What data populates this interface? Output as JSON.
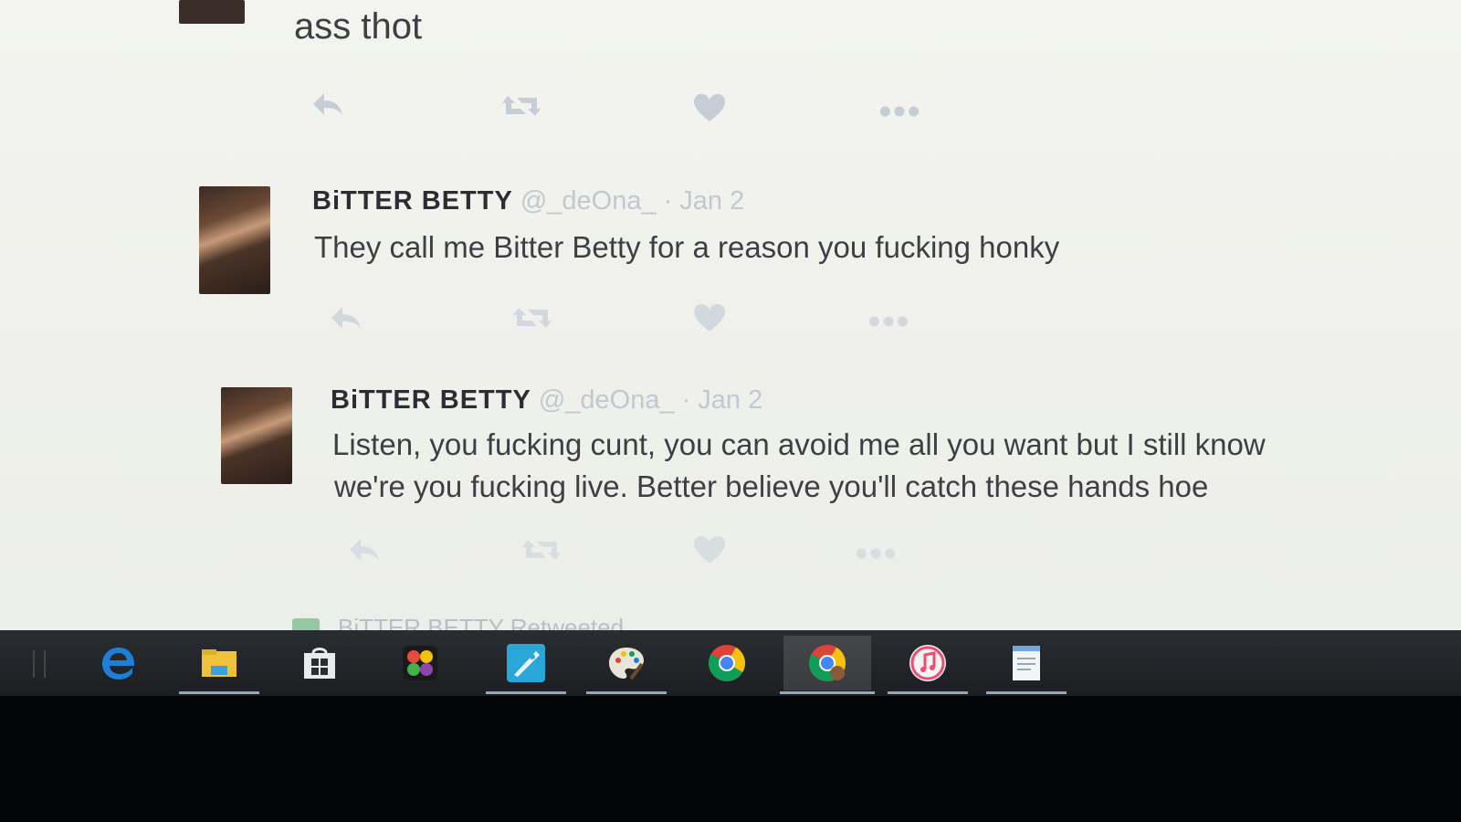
{
  "tweets": [
    {
      "text": "ass thot"
    },
    {
      "display_name": "BiTTER BETTY",
      "handle": "@_deOna_",
      "separator": "·",
      "date": "Jan 2",
      "text": "They call me Bitter Betty for a reason you fucking honky"
    },
    {
      "display_name": "BiTTER BETTY",
      "handle": "@_deOna_",
      "separator": "·",
      "date": "Jan 2",
      "text_line1": "Listen, you fucking cunt, you can avoid me all you want but I still know",
      "text_line2": "we're you fucking live. Better believe you'll catch these hands hoe"
    }
  ],
  "retweeted_notice": "BiTTER BETTY Retweeted",
  "action_icons": [
    "reply-icon",
    "retweet-icon",
    "like-icon",
    "more-icon"
  ],
  "taskbar": {
    "items": [
      {
        "name": "edge-icon",
        "active": false,
        "underline": false
      },
      {
        "name": "file-explorer-icon",
        "active": false,
        "underline": true
      },
      {
        "name": "store-icon",
        "active": false,
        "underline": false
      },
      {
        "name": "photos-app-icon",
        "active": false,
        "underline": false
      },
      {
        "name": "app-rocket-icon",
        "active": false,
        "underline": true
      },
      {
        "name": "paint-palette-icon",
        "active": false,
        "underline": true
      },
      {
        "name": "chrome-icon",
        "active": false,
        "underline": false
      },
      {
        "name": "chrome-profile-icon",
        "active": true,
        "underline": true
      },
      {
        "name": "itunes-icon",
        "active": false,
        "underline": true
      },
      {
        "name": "notepad-icon",
        "active": false,
        "underline": true
      }
    ]
  },
  "colors": {
    "edge_blue": "#1e7fd6",
    "explorer_yellow": "#f0c23c",
    "rocket_blue": "#2aa6d8",
    "chrome_red": "#db4437",
    "chrome_yellow": "#f4c20d",
    "chrome_green": "#0f9d58",
    "itunes_pink": "#ee4c73",
    "icon_gray": "#c6cdd4"
  }
}
